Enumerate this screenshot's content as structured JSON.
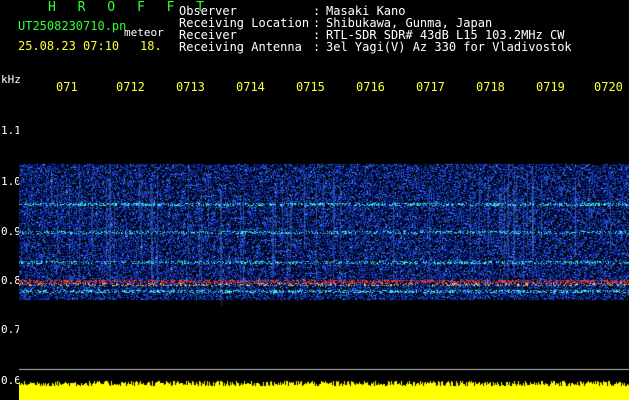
{
  "header": {
    "title": "H R O F F T",
    "filename": "UT2508230710.pn",
    "file_suffix": "meteor",
    "timestamp": "25.08.23 07:10",
    "frame": "18."
  },
  "info": [
    {
      "label": "Observer",
      "sep": ":",
      "value": "Masaki Kano"
    },
    {
      "label": "Receiving Location",
      "sep": ":",
      "value": "Shibukawa, Gunma, Japan"
    },
    {
      "label": "Receiver",
      "sep": ":",
      "value": "RTL-SDR SDR# 43dB L15 103.2MHz CW"
    },
    {
      "label": "Receiving Antenna",
      "sep": ":",
      "value": "3el Yagi(V) Az 330 for Vladivostok"
    }
  ],
  "y_axis": {
    "unit": "kHz",
    "ticks": [
      "1.1",
      "1.0",
      "0.9",
      "0.8",
      "0.7",
      "0.6"
    ]
  },
  "x_axis": {
    "ticks": [
      "071",
      "0712",
      "0713",
      "0714",
      "0715",
      "0716",
      "0717",
      "0718",
      "0719",
      "0720"
    ]
  },
  "colors": {
    "background": "#000000",
    "text_title": "#33ff33",
    "text_info": "#ffffff",
    "text_ticks": "#ffff33",
    "noise_low": "#0a1a8c",
    "noise_mid": "#2a6cff",
    "band_hot": "#ff3030",
    "band_cyan": "#33ffee",
    "bottom_bar": "#ffff00"
  }
}
